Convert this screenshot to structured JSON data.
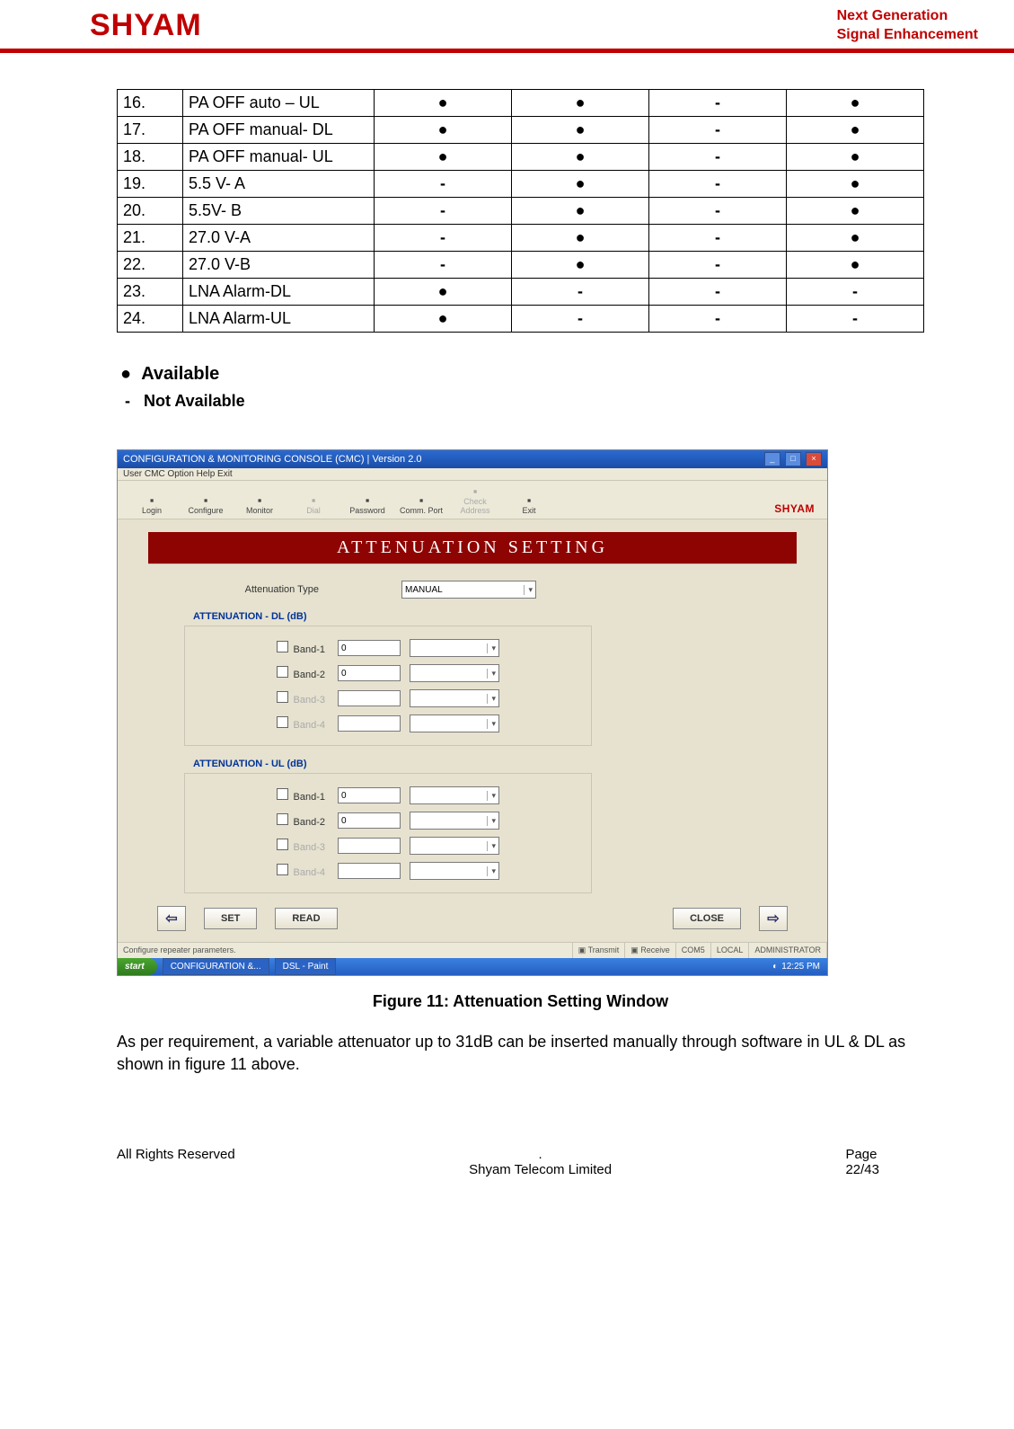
{
  "header": {
    "logo": "SHYAM",
    "tag1": "Next Generation",
    "tag2": "Signal Enhancement"
  },
  "table": {
    "rows": [
      {
        "num": "16.",
        "name": "PA OFF auto – UL",
        "c1": "●",
        "c2": "●",
        "c3": "-",
        "c4": "●"
      },
      {
        "num": "17.",
        "name": "PA OFF manual- DL",
        "c1": "●",
        "c2": "●",
        "c3": "-",
        "c4": "●"
      },
      {
        "num": "18.",
        "name": "PA OFF manual- UL",
        "c1": "●",
        "c2": "●",
        "c3": "-",
        "c4": "●"
      },
      {
        "num": "19.",
        "name": "5.5 V- A",
        "c1": "-",
        "c2": "●",
        "c3": "-",
        "c4": "●"
      },
      {
        "num": "20.",
        "name": "5.5V- B",
        "c1": "-",
        "c2": "●",
        "c3": "-",
        "c4": "●"
      },
      {
        "num": "21.",
        "name": "27.0 V-A",
        "c1": "-",
        "c2": "●",
        "c3": "-",
        "c4": "●"
      },
      {
        "num": "22.",
        "name": "27.0 V-B",
        "c1": "-",
        "c2": "●",
        "c3": "-",
        "c4": "●"
      },
      {
        "num": "23.",
        "name": "LNA Alarm-DL",
        "c1": "●",
        "c2": "-",
        "c3": "-",
        "c4": "-"
      },
      {
        "num": "24.",
        "name": "LNA Alarm-UL",
        "c1": "●",
        "c2": "-",
        "c3": "-",
        "c4": "-"
      }
    ]
  },
  "legend": {
    "available": "Available",
    "not_available": "Not Available"
  },
  "screenshot": {
    "title": "CONFIGURATION & MONITORING CONSOLE (CMC)  |  Version 2.0",
    "menu": "User   CMC   Option   Help   Exit",
    "toolbar": [
      {
        "label": "Login",
        "dis": false
      },
      {
        "label": "Configure",
        "dis": false
      },
      {
        "label": "Monitor",
        "dis": false
      },
      {
        "label": "Dial",
        "dis": true
      },
      {
        "label": "Password",
        "dis": false
      },
      {
        "label": "Comm. Port",
        "dis": false
      },
      {
        "label": "Check Address",
        "dis": true
      },
      {
        "label": "Exit",
        "dis": false
      }
    ],
    "brand": "SHYAM",
    "banner": "ATTENUATION SETTING",
    "att_type_label": "Attenuation Type",
    "att_type_value": "MANUAL",
    "group_dl": "ATTENUATION - DL (dB)",
    "group_ul": "ATTENUATION - UL (dB)",
    "bands": [
      {
        "label": "Band-1",
        "val": "0",
        "dis": false
      },
      {
        "label": "Band-2",
        "val": "0",
        "dis": false
      },
      {
        "label": "Band-3",
        "val": "",
        "dis": true
      },
      {
        "label": "Band-4",
        "val": "",
        "dis": true
      }
    ],
    "btn_set": "SET",
    "btn_read": "READ",
    "btn_close": "CLOSE",
    "status": {
      "msg": "Configure repeater parameters.",
      "tx": "Transmit",
      "rx": "Receive",
      "port": "COM5",
      "mode": "LOCAL",
      "user": "ADMINISTRATOR"
    },
    "taskbar": {
      "start": "start",
      "task1": "CONFIGURATION &...",
      "task2": "DSL - Paint",
      "clock": "12:25 PM"
    }
  },
  "caption": "Figure 11: Attenuation Setting Window",
  "para": "As per requirement, a variable attenuator up to 31dB can be inserted manually through software in UL & DL as shown in figure 11 above.",
  "footer": {
    "left": "All Rights Reserved",
    "center_dot": ".",
    "center": "Shyam Telecom Limited",
    "right_label": "Page",
    "right_num": "22/43"
  }
}
